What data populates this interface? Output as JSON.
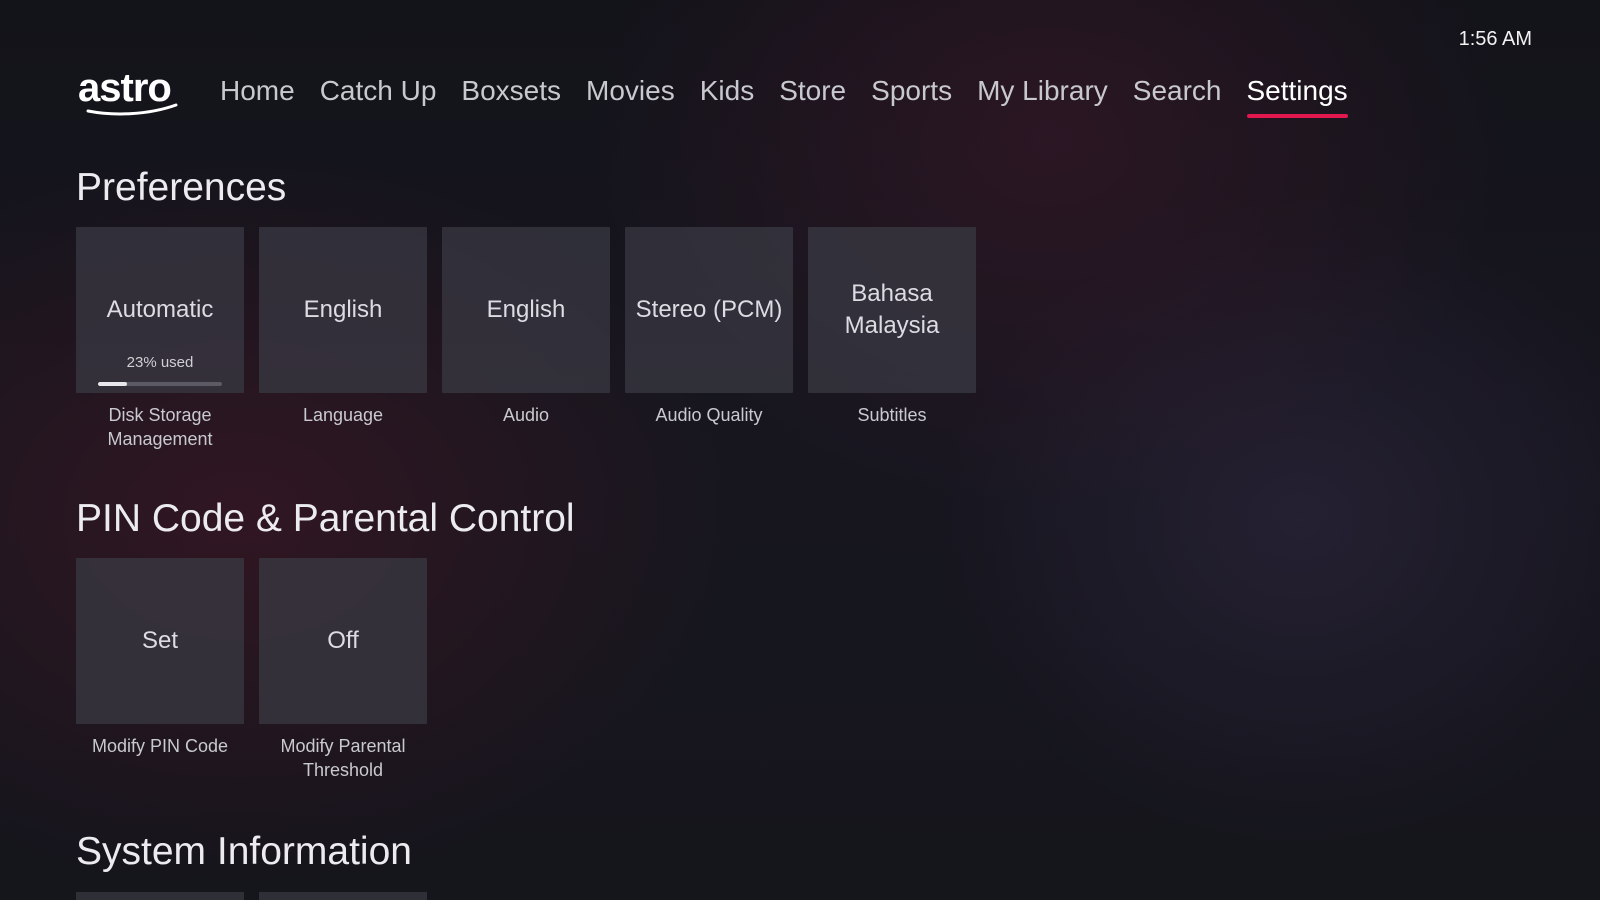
{
  "clock": "1:56 AM",
  "brand": {
    "logo_text": "astro"
  },
  "nav": {
    "items": [
      {
        "label": "Home",
        "active": false
      },
      {
        "label": "Catch Up",
        "active": false
      },
      {
        "label": "Boxsets",
        "active": false
      },
      {
        "label": "Movies",
        "active": false
      },
      {
        "label": "Kids",
        "active": false
      },
      {
        "label": "Store",
        "active": false
      },
      {
        "label": "Sports",
        "active": false
      },
      {
        "label": "My Library",
        "active": false
      },
      {
        "label": "Search",
        "active": false
      },
      {
        "label": "Settings",
        "active": true
      }
    ],
    "accent_color": "#e3174f"
  },
  "preferences": {
    "title": "Preferences",
    "tiles": [
      {
        "value": "Automatic",
        "caption": "Disk Storage Management",
        "usage_text": "23% used",
        "usage_fraction": 0.23
      },
      {
        "value": "English",
        "caption": "Language"
      },
      {
        "value": "English",
        "caption": "Audio"
      },
      {
        "value": "Stereo (PCM)",
        "caption": "Audio Quality"
      },
      {
        "value": "Bahasa Malaysia",
        "caption": "Subtitles"
      }
    ]
  },
  "pin": {
    "title": "PIN Code & Parental Control",
    "tiles": [
      {
        "value": "Set",
        "caption": "Modify PIN Code"
      },
      {
        "value": "Off",
        "caption": "Modify Parental Threshold"
      }
    ]
  },
  "system": {
    "title": "System Information"
  }
}
